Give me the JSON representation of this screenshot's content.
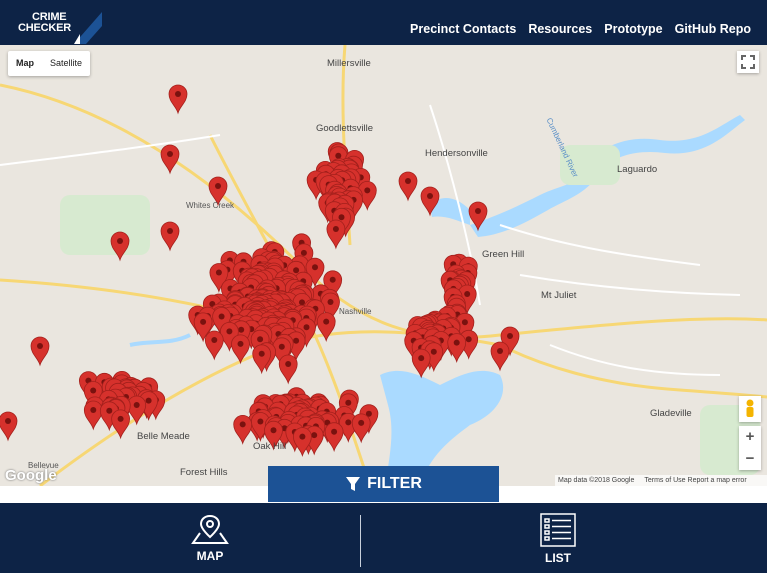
{
  "header": {
    "logo_line1": "CRIME",
    "logo_line2": "CHECKER",
    "nav": [
      "Precinct Contacts",
      "Resources",
      "Prototype",
      "GitHub Repo"
    ]
  },
  "map": {
    "type_control": {
      "options": [
        "Map",
        "Satellite"
      ],
      "selected": "Map"
    },
    "places": [
      "Millersville",
      "Goodlettsville",
      "Hendersonville",
      "Laguardo",
      "Green Hill",
      "Mt Juliet",
      "Gladeville",
      "Belle Meade",
      "Oak Hill",
      "Forest Hills",
      "Bellevue",
      "Whites Creek",
      "Nashville",
      "Cumberland River"
    ],
    "attribution": "Map data ©2018 Google",
    "attribution_extra": "Terms of Use   Report a map error",
    "google_logo": "Google",
    "zoom_in": "+",
    "zoom_out": "−",
    "marker_color": "#d6312c"
  },
  "filter_button": {
    "label": "FILTER",
    "icon": "funnel-icon"
  },
  "bottom_tabs": [
    {
      "label": "MAP",
      "icon": "map-pin-icon"
    },
    {
      "label": "LIST",
      "icon": "list-icon"
    }
  ]
}
